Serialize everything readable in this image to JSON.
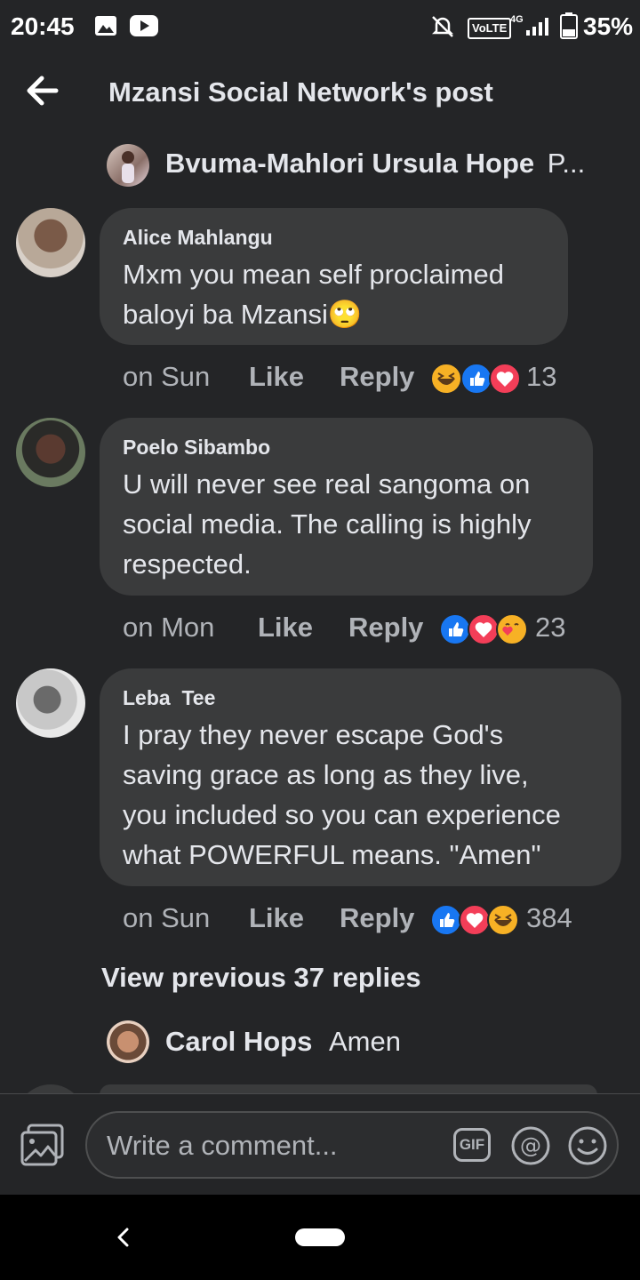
{
  "status_bar": {
    "time": "20:45",
    "network_label": "VoLTE",
    "network_gen": "4G",
    "battery": "35%"
  },
  "header": {
    "title": "Mzansi Social Network's post"
  },
  "reply_to": {
    "name": "Bvuma-Mahlori Ursula Hope",
    "text": "P..."
  },
  "comments": [
    {
      "name": "Alice Mahlangu",
      "lines": [
        "Mxm you mean self proclaimed",
        "baloyi ba Mzansi🙄"
      ],
      "time": "on Sun",
      "like": "Like",
      "reply": "Reply",
      "reaction_count": "13",
      "reactions": [
        "haha-icon",
        "like-icon",
        "love-icon"
      ]
    },
    {
      "name": "Poelo Sibambo",
      "lines": [
        "U will never see real sangoma on",
        "social media. The calling is highly",
        "respected."
      ],
      "time": "on Mon",
      "like": "Like",
      "reply": "Reply",
      "reaction_count": "23",
      "reactions": [
        "like-icon",
        "love-icon",
        "care-icon"
      ]
    },
    {
      "name": "Leba  Tee",
      "lines": [
        "I pray they never escape God's",
        "saving grace as long as they live,",
        "you included so you can experience",
        "what POWERFUL means. \"Amen\""
      ],
      "time": "on Sun",
      "like": "Like",
      "reply": "Reply",
      "reaction_count": "384",
      "reactions": [
        "like-icon",
        "love-icon",
        "haha-icon"
      ]
    }
  ],
  "view_previous": "View previous 37 replies",
  "reply_preview": {
    "name": "Carol Hops",
    "text": "Amen"
  },
  "composer": {
    "placeholder": "Write a comment...",
    "gif_label": "GIF"
  },
  "colors": {
    "background": "#242527",
    "bubble": "#3a3b3c",
    "like_blue": "#1877f2",
    "love_red": "#f33e58",
    "haha_yellow": "#f7b125"
  }
}
